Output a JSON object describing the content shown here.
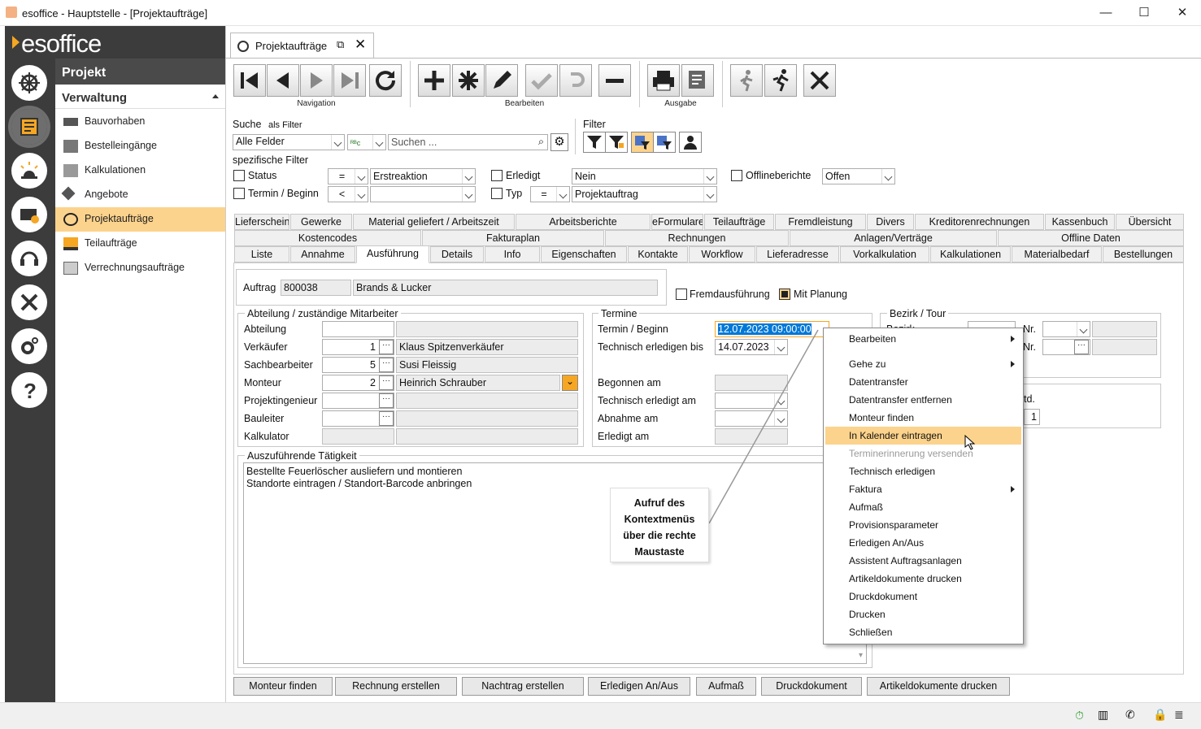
{
  "window": {
    "title": "esoffice - Hauptstelle - [Projektaufträge]",
    "min": "—",
    "max": "☐",
    "close": "✕"
  },
  "logo": "esoffice",
  "nav": {
    "header": "Projekt",
    "section": "Verwaltung",
    "items": [
      {
        "label": "Bauvorhaben"
      },
      {
        "label": "Bestelleingänge"
      },
      {
        "label": "Kalkulationen"
      },
      {
        "label": "Angebote"
      },
      {
        "label": "Projektaufträge"
      },
      {
        "label": "Teilaufträge"
      },
      {
        "label": "Verrechnungsaufträge"
      }
    ]
  },
  "doc_tab": {
    "label": "Projektaufträge"
  },
  "toolbar": {
    "groups": [
      "Navigation",
      "Bearbeiten",
      "Ausgabe"
    ]
  },
  "search": {
    "label": "Suche",
    "sub": "als Filter",
    "field": "Alle Felder",
    "placeholder": "Suchen ...",
    "filter_label": "Filter"
  },
  "spec_filter": {
    "title": "spezifische Filter",
    "status": "Status",
    "status_op": "=",
    "status_val": "Erstreaktion",
    "termin": "Termin / Beginn",
    "termin_op": "<",
    "erledigt": "Erledigt",
    "erledigt_val": "Nein",
    "typ": "Typ",
    "typ_op": "=",
    "typ_val": "Projektauftrag",
    "offline": "Offlineberichte",
    "offline_val": "Offen"
  },
  "tabs_row1": [
    "Lieferscheine",
    "Gewerke",
    "Material geliefert / Arbeitszeit",
    "Arbeitsberichte",
    "eFormulare",
    "Teilaufträge",
    "Fremdleistung",
    "Divers",
    "Kreditorenrechnungen",
    "Kassenbuch",
    "Übersicht"
  ],
  "tabs_row2": [
    "Kostencodes",
    "Fakturaplan",
    "Rechnungen",
    "Anlagen/Verträge",
    "Offline Daten"
  ],
  "tabs_row3": [
    "Liste",
    "Annahme",
    "Ausführung",
    "Details",
    "Info",
    "Eigenschaften",
    "Kontakte",
    "Workflow",
    "Lieferadresse",
    "Vorkalkulation",
    "Kalkulationen",
    "Materialbedarf",
    "Bestellungen"
  ],
  "auftrag": {
    "label": "Auftrag",
    "nr": "800038",
    "name": "Brands & Lucker",
    "fremd": "Fremdausführung",
    "planung": "Mit Planung"
  },
  "abteilung": {
    "title": "Abteilung / zuständige Mitarbeiter",
    "rows": [
      {
        "label": "Abteilung",
        "num": "",
        "name": ""
      },
      {
        "label": "Verkäufer",
        "num": "1",
        "name": "Klaus Spitzenverkäufer"
      },
      {
        "label": "Sachbearbeiter",
        "num": "5",
        "name": "Susi Fleissig"
      },
      {
        "label": "Monteur",
        "num": "2",
        "name": "Heinrich Schrauber"
      },
      {
        "label": "Projektingenieur",
        "num": "",
        "name": ""
      },
      {
        "label": "Bauleiter",
        "num": "",
        "name": ""
      },
      {
        "label": "Kalkulator",
        "num": "",
        "name": ""
      }
    ]
  },
  "termine": {
    "title": "Termine",
    "beginn_label": "Termin / Beginn",
    "beginn": "12.07.2023 09:00:00",
    "tech_bis_label": "Technisch erledigen bis",
    "tech_bis": "14.07.2023",
    "begonnen": "Begonnen am",
    "tech_am": "Technisch erledigt am",
    "abnahme": "Abnahme am",
    "erledigt": "Erledigt am"
  },
  "bezirk": {
    "title": "Bezirk / Tour",
    "bezirk": "Bezirk",
    "nr": "Nr.",
    "std": "td.",
    "val": "1"
  },
  "taetigkeit": {
    "title": "Auszuführende Tätigkeit",
    "line1": "Bestellte Feuerlöscher ausliefern und montieren",
    "line2": "Standorte eintragen / Standort-Barcode anbringen"
  },
  "callout": "Aufruf des Kontextmenüs über die rechte Maustaste",
  "context_menu": [
    {
      "label": "Bearbeiten",
      "sub": true
    },
    {
      "label": "Gehe zu",
      "sub": true
    },
    {
      "label": "Datentransfer"
    },
    {
      "label": "Datentransfer entfernen"
    },
    {
      "label": "Monteur finden"
    },
    {
      "label": "In Kalender eintragen",
      "hl": true
    },
    {
      "label": "Terminerinnerung versenden",
      "dis": true
    },
    {
      "label": "Technisch erledigen"
    },
    {
      "label": "Faktura",
      "sub": true
    },
    {
      "label": "Aufmaß"
    },
    {
      "label": "Provisionsparameter"
    },
    {
      "label": "Erledigen An/Aus"
    },
    {
      "label": "Assistent Auftragsanlagen"
    },
    {
      "label": "Artikeldokumente drucken"
    },
    {
      "label": "Druckdokument"
    },
    {
      "label": "Drucken"
    },
    {
      "label": "Schließen"
    }
  ],
  "bottom_buttons": [
    "Monteur finden",
    "Rechnung erstellen",
    "Nachtrag erstellen",
    "Erledigen An/Aus",
    "Aufmaß",
    "Druckdokument",
    "Artikeldokumente drucken"
  ],
  "colors": {
    "accent": "#fcd38c",
    "rail": "#3c3c3c",
    "brand": "#f5a623"
  }
}
